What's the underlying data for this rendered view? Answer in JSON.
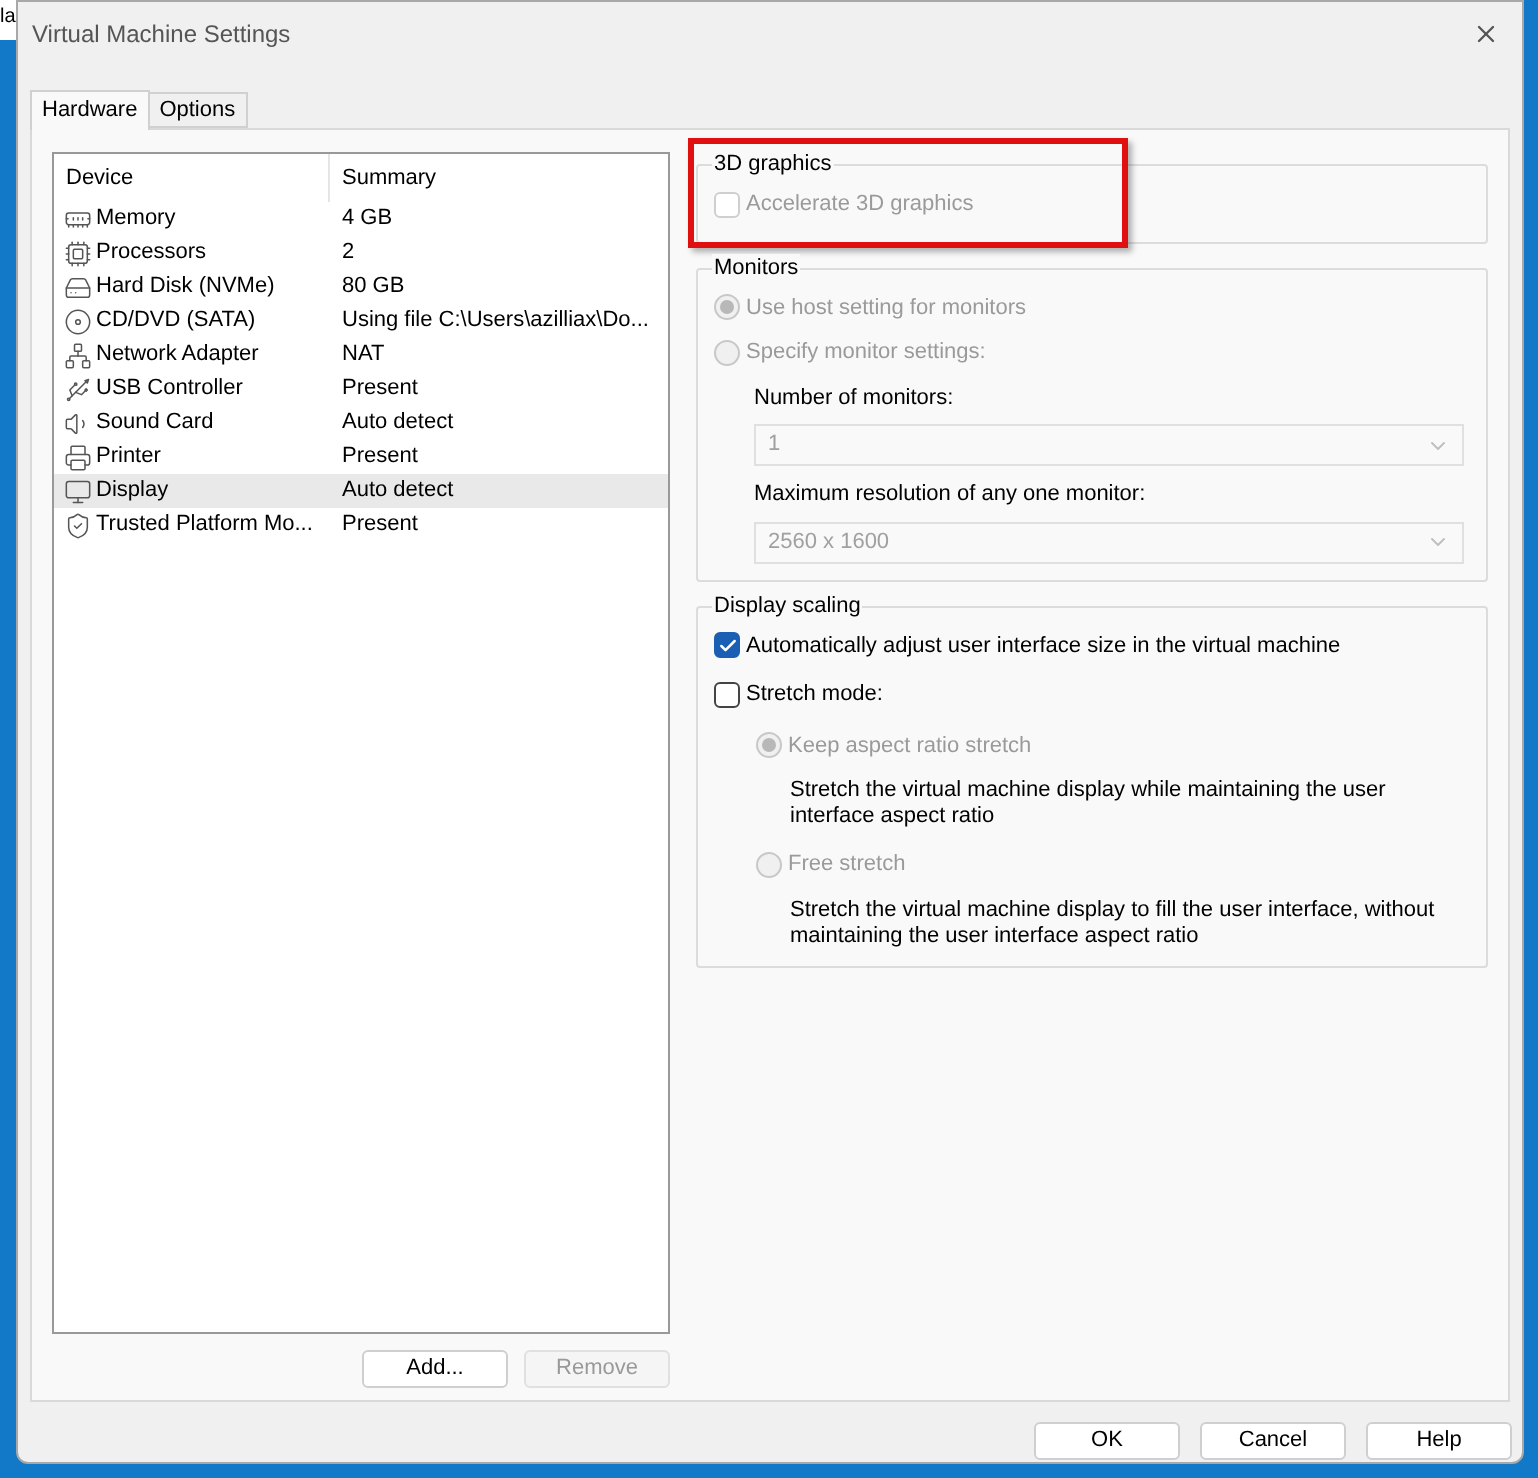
{
  "background_window": {
    "text": "la"
  },
  "window": {
    "title": "Virtual Machine Settings"
  },
  "tabs": [
    {
      "label": "Hardware",
      "selected": true
    },
    {
      "label": "Options",
      "selected": false
    }
  ],
  "device_table": {
    "columns": [
      "Device",
      "Summary"
    ],
    "rows": [
      {
        "kind": "memory",
        "device": "Memory",
        "summary": "4 GB",
        "selected": false
      },
      {
        "kind": "cpu",
        "device": "Processors",
        "summary": "2",
        "selected": false
      },
      {
        "kind": "disk",
        "device": "Hard Disk (NVMe)",
        "summary": "80 GB",
        "selected": false
      },
      {
        "kind": "cd",
        "device": "CD/DVD (SATA)",
        "summary": "Using file C:\\Users\\azilliax\\Do...",
        "selected": false
      },
      {
        "kind": "network",
        "device": "Network Adapter",
        "summary": "NAT",
        "selected": false
      },
      {
        "kind": "usb",
        "device": "USB Controller",
        "summary": "Present",
        "selected": false
      },
      {
        "kind": "sound",
        "device": "Sound Card",
        "summary": "Auto detect",
        "selected": false
      },
      {
        "kind": "printer",
        "device": "Printer",
        "summary": "Present",
        "selected": false
      },
      {
        "kind": "display",
        "device": "Display",
        "summary": "Auto detect",
        "selected": true
      },
      {
        "kind": "tpm",
        "device": "Trusted Platform Mo...",
        "summary": "Present",
        "selected": false
      }
    ]
  },
  "list_buttons": [
    {
      "label": "Add...",
      "disabled": false
    },
    {
      "label": "Remove",
      "disabled": true
    }
  ],
  "graphics_3d": {
    "title": "3D graphics",
    "accelerate": {
      "label": "Accelerate 3D graphics",
      "checked": false,
      "disabled": true
    },
    "highlighted": true
  },
  "monitors": {
    "title": "Monitors",
    "options": [
      {
        "label": "Use host setting for monitors",
        "selected": true,
        "disabled": true
      },
      {
        "label": "Specify monitor settings:",
        "selected": false,
        "disabled": true
      }
    ],
    "number_label": "Number of monitors:",
    "number_value": "1",
    "resolution_label": "Maximum resolution of any one monitor:",
    "resolution_value": "2560 x 1600"
  },
  "display_scaling": {
    "title": "Display scaling",
    "auto_adjust": {
      "label": "Automatically adjust user interface size in the virtual machine",
      "checked": true
    },
    "stretch": {
      "label": "Stretch mode:",
      "checked": false
    },
    "stretch_options": [
      {
        "label": "Keep aspect ratio stretch",
        "selected": true,
        "disabled": true,
        "description": "Stretch the virtual machine display while maintaining the user interface aspect ratio"
      },
      {
        "label": "Free stretch",
        "selected": false,
        "disabled": true,
        "description": "Stretch the virtual machine display to fill the user interface, without maintaining the user interface aspect ratio"
      }
    ]
  },
  "dialog_buttons": [
    "OK",
    "Cancel",
    "Help"
  ]
}
